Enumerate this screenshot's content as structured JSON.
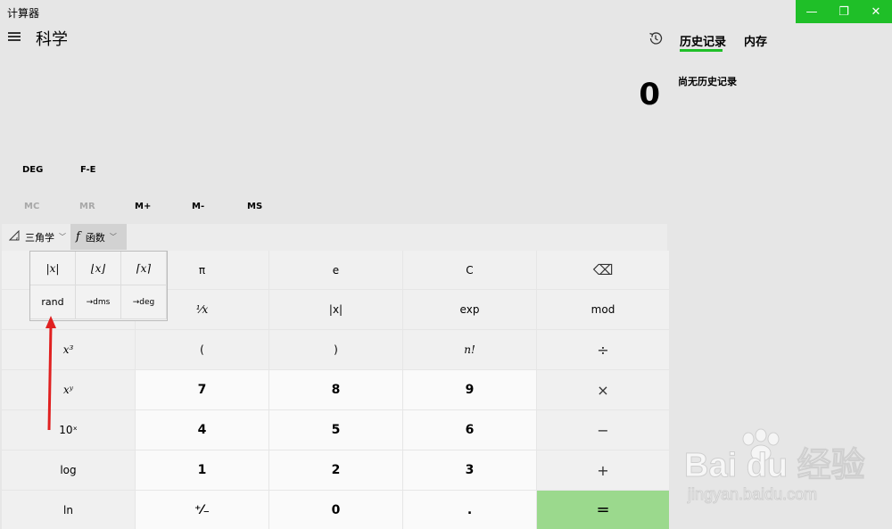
{
  "window": {
    "title": "计算器",
    "controls": [
      "—",
      "❐",
      "✕"
    ]
  },
  "header": {
    "mode_title": "科学"
  },
  "display": {
    "value": "0"
  },
  "panel": {
    "tabs": [
      "历史记录",
      "内存"
    ],
    "empty_text": "尚无历史记录"
  },
  "modes": {
    "angle": "DEG",
    "fe": "F-E"
  },
  "memory": [
    "MC",
    "MR",
    "M+",
    "M-",
    "MS"
  ],
  "toolbar": {
    "trig_label": "三角学",
    "func_icon": "f",
    "func_label": "函数"
  },
  "popup": {
    "keys": [
      "|x|",
      "⌊x⌋",
      "⌈x⌉",
      "rand",
      "→dms",
      "→deg"
    ]
  },
  "keys": [
    [
      "",
      "π",
      "e",
      "C",
      "⌫"
    ],
    [
      "",
      "¹⁄x",
      "|x|",
      "exp",
      "mod"
    ],
    [
      "x³",
      "(",
      ")",
      "n!",
      "÷"
    ],
    [
      "xʸ",
      "7",
      "8",
      "9",
      "×"
    ],
    [
      "10ˣ",
      "4",
      "5",
      "6",
      "−"
    ],
    [
      "log",
      "1",
      "2",
      "3",
      "+"
    ],
    [
      "ln",
      "⁺⁄₋",
      "0",
      ".",
      "="
    ]
  ],
  "watermark": {
    "brand": "Bai du 经验",
    "url": "jingyan.baidu.com"
  },
  "colors": {
    "accent": "#1fbf28",
    "equals": "#9bd98d",
    "annotation_arrow": "#e02020"
  }
}
